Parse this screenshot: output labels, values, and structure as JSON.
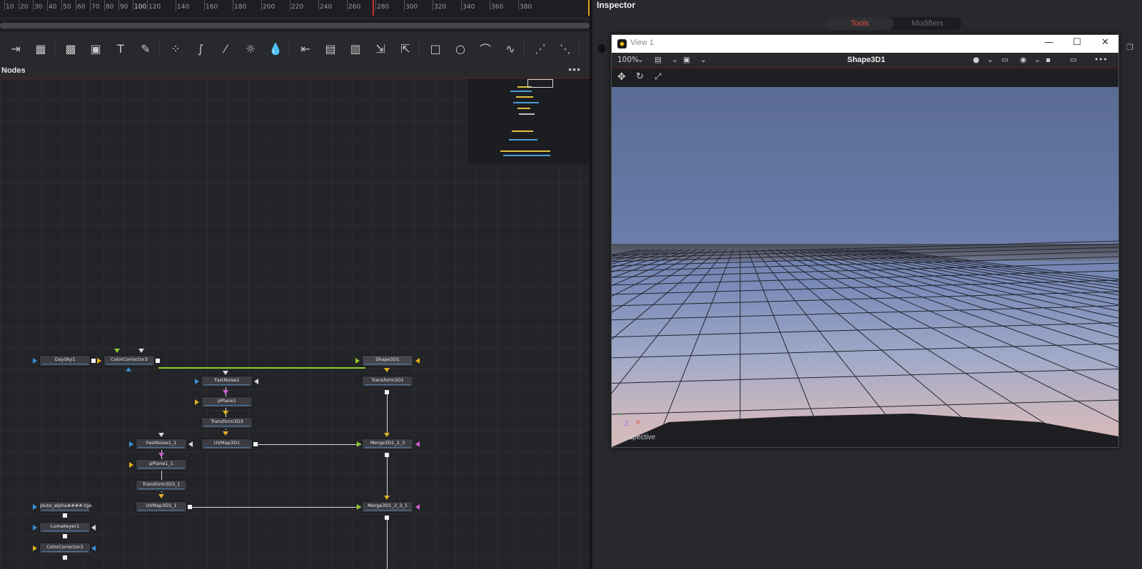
{
  "ruler": {
    "ticks": [
      "10",
      "20",
      "30",
      "40",
      "50",
      "60",
      "70",
      "80",
      "90",
      "100",
      "120",
      "140",
      "160",
      "180",
      "200",
      "220",
      "240",
      "260",
      "280",
      "300",
      "320",
      "340",
      "360",
      "380"
    ]
  },
  "nodes_panel": {
    "title": "Nodes",
    "menu": "•••"
  },
  "toolbar_icons": [
    "merge-icon",
    "background-icon",
    "image-icon",
    "mask-icon",
    "text-icon",
    "paint-icon",
    "particles-icon",
    "curves-icon",
    "color-curves-icon",
    "brightness-icon",
    "blur-icon",
    "loader-icon",
    "saver-icon",
    "viewer-icon",
    "transform-icon",
    "resize-icon",
    "rectangle-icon",
    "ellipse-icon",
    "polygon-icon",
    "bspline-icon",
    "emitter-icon",
    "renderer-icon"
  ],
  "nodes": [
    {
      "id": "daysky",
      "label": "DaySky1"
    },
    {
      "id": "cc3",
      "label": "ColorCorrector3"
    },
    {
      "id": "shape3d",
      "label": "Shape3D1"
    },
    {
      "id": "fastnoise1",
      "label": "FastNoise1"
    },
    {
      "id": "transform3d1",
      "label": "Transform3D1"
    },
    {
      "id": "pplane1",
      "label": "pPlane1"
    },
    {
      "id": "transform3d3",
      "label": "Transform3D3"
    },
    {
      "id": "uvmap3d1",
      "label": "UVMap3D1"
    },
    {
      "id": "fastnoise1_1",
      "label": "FastNoise1_1"
    },
    {
      "id": "merge3d1_2_3",
      "label": "Merge3D1_2_3"
    },
    {
      "id": "pplane1_1",
      "label": "pPlane1_1"
    },
    {
      "id": "transform3d3_1",
      "label": "Transform3D3_1"
    },
    {
      "id": "uvmap3d1_1",
      "label": "UVMap3D1_1"
    },
    {
      "id": "merge3d1_2_3_1",
      "label": "Merge3D1_2_3_1"
    },
    {
      "id": "pluto",
      "label": "pluto_alpha####.tga"
    },
    {
      "id": "lumakeyer1",
      "label": "LumaKeyer1"
    },
    {
      "id": "cc2",
      "label": "ColorCorrector2"
    }
  ],
  "inspector": {
    "title": "Inspector",
    "tabs": [
      "Tools",
      "Modifiers"
    ],
    "active_tab": "Tools"
  },
  "view_window": {
    "title": "View 1",
    "zoom": "100%",
    "viewer_name": "Shape3D1",
    "camera_label": "Perspective",
    "axes": {
      "y": "Y",
      "x": "X",
      "z": "Z"
    }
  },
  "colors": {
    "accent_red": "#e24b3b",
    "wire_green": "#8ecb2a",
    "input_blue": "#3a8fd8",
    "input_yellow": "#e0b020",
    "input_magenta": "#d060d0"
  }
}
